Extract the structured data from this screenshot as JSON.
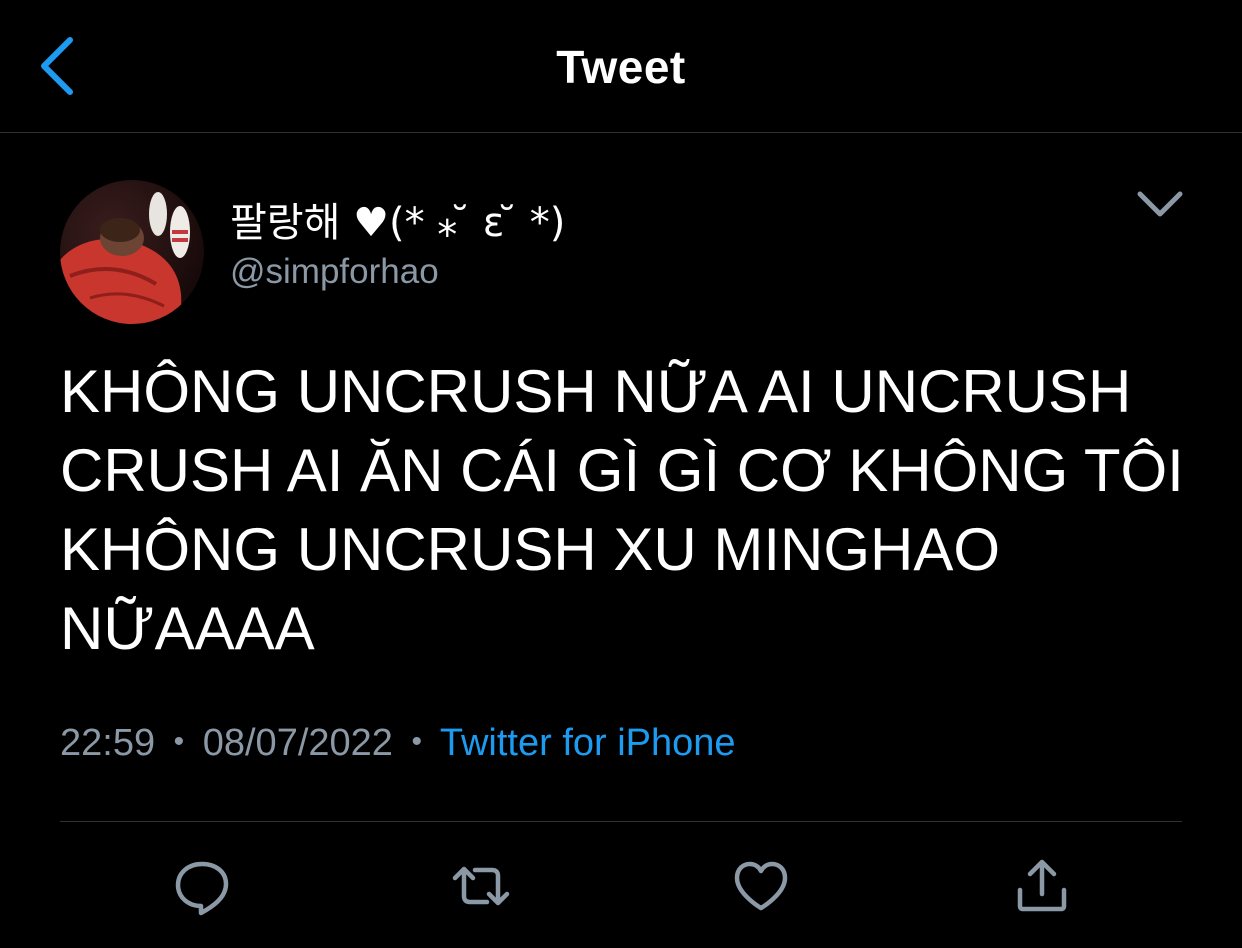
{
  "header": {
    "title": "Tweet",
    "back_icon": "chevron-left-icon"
  },
  "tweet": {
    "author": {
      "display_name": "팔랑해 ♥(* ⁎ ̆ ɛ ̆ *)",
      "handle": "@simpforhao",
      "avatar": "avatar-image"
    },
    "menu_icon": "chevron-down-icon",
    "text": "KHÔNG UNCRUSH NỮA AI UNCRUSH\nCRUSH AI ĂN CÁI GÌ GÌ CƠ KHÔNG TÔI\nKHÔNG UNCRUSH XU MINGHAO\nNỮAAAA",
    "time": "22:59",
    "date": "08/07/2022",
    "separator": "•",
    "source": "Twitter for iPhone"
  },
  "actions": [
    {
      "name": "reply",
      "icon": "comment-icon"
    },
    {
      "name": "retweet",
      "icon": "retweet-icon"
    },
    {
      "name": "like",
      "icon": "heart-icon"
    },
    {
      "name": "share",
      "icon": "share-icon"
    }
  ],
  "colors": {
    "background": "#000000",
    "text": "#ffffff",
    "secondary_text": "#8b98a5",
    "accent": "#1d9bf0",
    "divider": "#2f3336"
  }
}
